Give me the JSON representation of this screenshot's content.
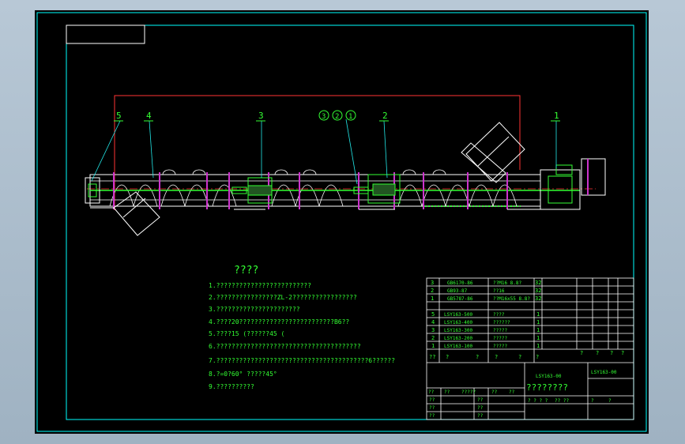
{
  "balloons": {
    "b1": "1",
    "b2": "2",
    "b3": "3",
    "b4": "4",
    "b5": "5",
    "b321": [
      "3",
      "2",
      "1"
    ]
  },
  "notes": {
    "title": "????",
    "lines": [
      "1.?????????????????????????",
      "2.????????????????ZL-2?????????????????",
      "3.??????????????????????",
      "4.????20?????????????????????????B6??",
      "5.????15 (??????45 (",
      "6.??????????????????????????????????????",
      "7.????????????????????????????????????????6??????",
      "8.?=0?60° ?????45°",
      "9.??????????"
    ]
  },
  "bom": {
    "std_rows": [
      {
        "no": "3",
        "code": "GB6170-86",
        "name": "??M16 8.8?",
        "qty": "32"
      },
      {
        "no": "2",
        "code": "GB93-87",
        "name": "??16",
        "qty": "32"
      },
      {
        "no": "1",
        "code": "GB5787-86",
        "name": "??M16x55 8.8?",
        "qty": "32"
      }
    ],
    "part_rows": [
      {
        "no": "5",
        "code": "LSY163-500",
        "name": "????",
        "qty": "1"
      },
      {
        "no": "4",
        "code": "LSY163-400",
        "name": "??????",
        "qty": "1"
      },
      {
        "no": "3",
        "code": "LSY163-300",
        "name": "?????",
        "qty": "1"
      },
      {
        "no": "2",
        "code": "LSY163-200",
        "name": "?????",
        "qty": "1"
      },
      {
        "no": "1",
        "code": "LSY163-100",
        "name": "?????",
        "qty": "1"
      }
    ],
    "header_cells": [
      "??",
      "?",
      "?",
      "?",
      "?",
      "?"
    ],
    "right_header_cells": [
      "?",
      "?",
      "?",
      "?"
    ]
  },
  "title_block": {
    "drawing_no_left": "LSY163-00",
    "drawing_no_right": "LSY163-00",
    "name": "????????",
    "sign_labels": [
      "??",
      "??",
      "?????",
      "??",
      "??"
    ],
    "bottom_labels": [
      "? ? ? ?",
      "?? ??",
      "?",
      "?"
    ],
    "left_stack": [
      "??",
      "??",
      "??",
      "??"
    ],
    "mid_stack": [
      "??",
      "??",
      "??"
    ]
  },
  "colors": {
    "background": "#000000",
    "frame": "#00ffff",
    "structure": "#ffffff",
    "text": "#33ff33",
    "centerline": "#ff3333",
    "flange": "#cc33cc",
    "leader": "#22e6e6"
  }
}
